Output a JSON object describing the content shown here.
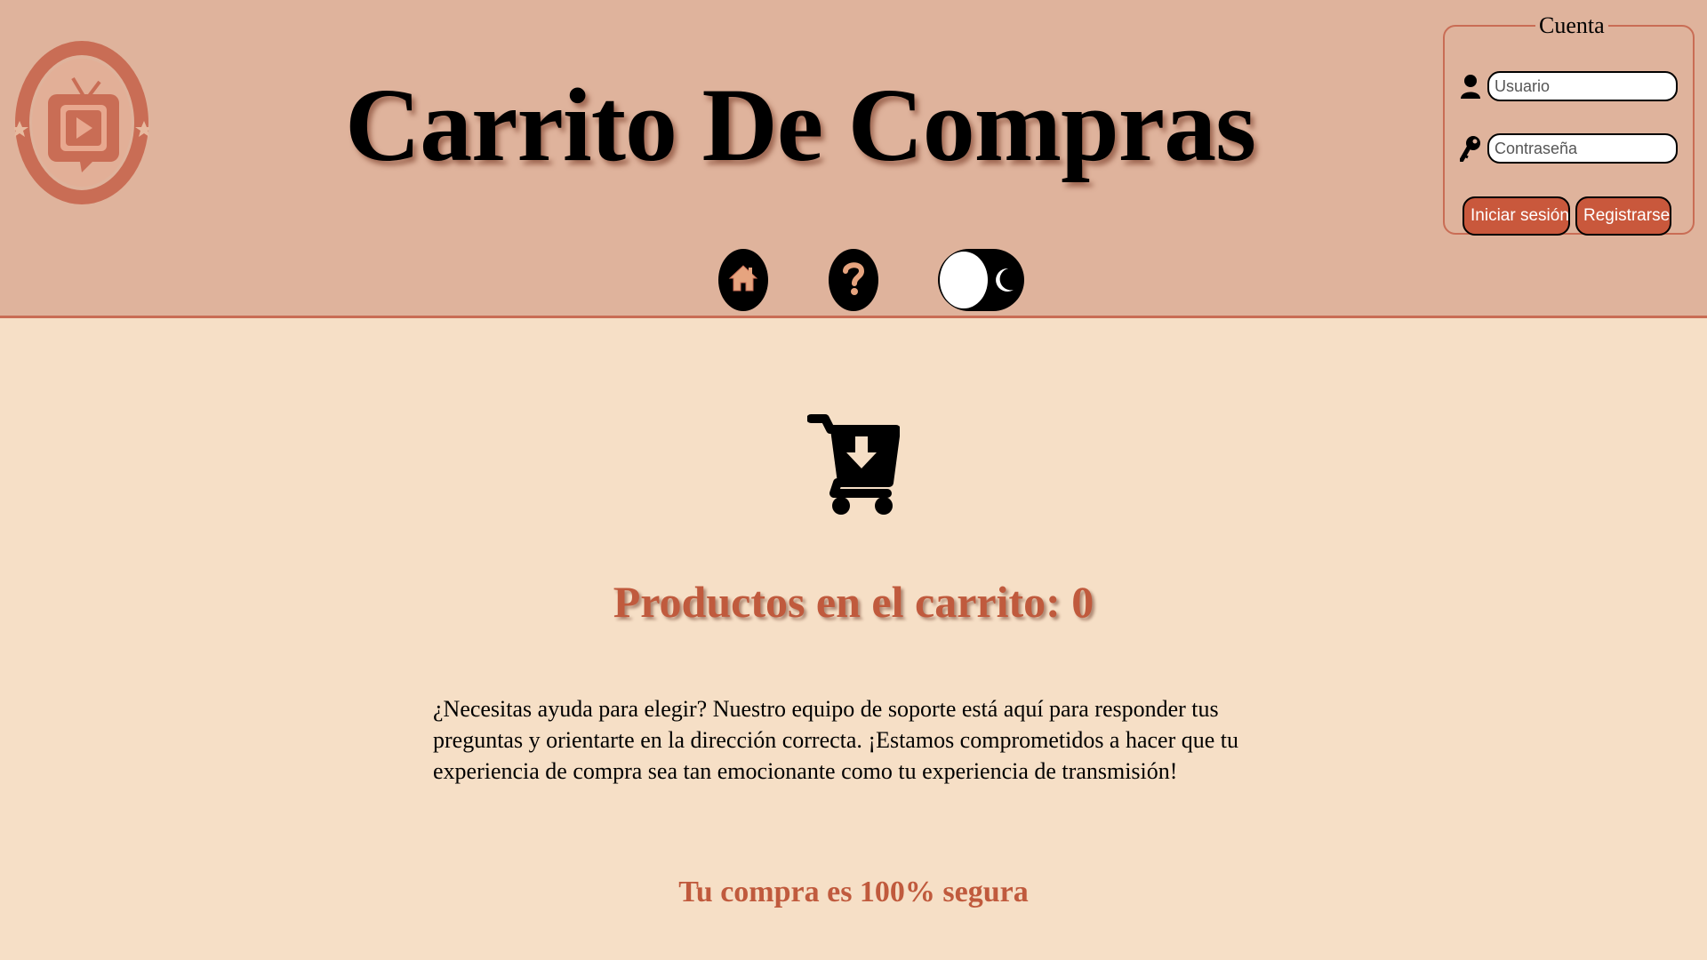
{
  "header": {
    "title": "Carrito De Compras"
  },
  "nav": {
    "home_icon": "home-icon",
    "help_icon": "question-icon",
    "theme_toggle_icon": "moon-icon",
    "theme_toggle_state": "light"
  },
  "account": {
    "legend": "Cuenta",
    "username_placeholder": "Usuario",
    "username_value": "",
    "password_placeholder": "Contraseña",
    "password_value": "",
    "login_label": "Iniciar sesión",
    "register_label": "Registrarse",
    "user_icon": "user-icon",
    "key_icon": "key-icon"
  },
  "main": {
    "cart_icon": "cart-download-icon",
    "cart_count_text": "Productos en el carrito: 0",
    "help_paragraph": "¿Necesitas ayuda para elegir? Nuestro equipo de soporte está aquí para responder tus preguntas y orientarte en la dirección correcta. ¡Estamos comprometidos a hacer que tu experiencia de compra sea tan emocionante como tu experiencia de transmisión!",
    "secure_text": "Tu compra es 100% segura"
  },
  "colors": {
    "header_background": "#dfb39c",
    "page_background": "#f6dfc6",
    "accent": "#c9583c",
    "heading_accent": "#c05a3d"
  }
}
